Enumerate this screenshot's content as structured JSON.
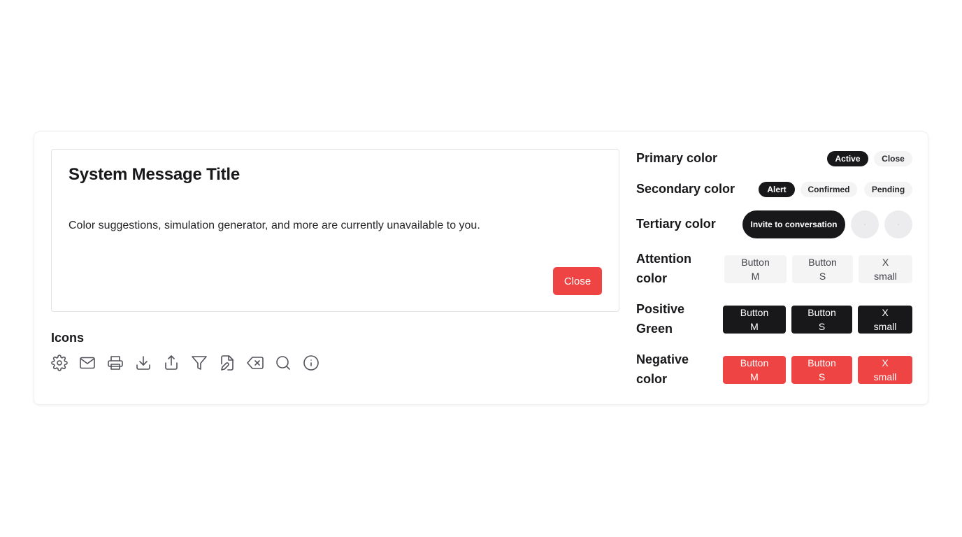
{
  "message": {
    "title": "System Message Title",
    "body": "Color suggestions, simulation generator, and more are currently unavailable to you.",
    "close_label": "Close"
  },
  "icons": {
    "title": "Icons",
    "items": [
      "gear-icon",
      "mail-icon",
      "printer-icon",
      "download-icon",
      "upload-icon",
      "filter-icon",
      "file-edit-icon",
      "backspace-icon",
      "search-icon",
      "info-icon"
    ]
  },
  "colors": {
    "primary": "#18181b",
    "attention_bg": "#f4f4f5",
    "negative": "#ef4444"
  },
  "primary": {
    "label": "Primary color",
    "tags": [
      "Active",
      "Close"
    ]
  },
  "secondary": {
    "label": "Secondary color",
    "tags": [
      "Alert",
      "Confirmed",
      "Pending"
    ]
  },
  "tertiary": {
    "label": "Tertiary color",
    "button": "Invite to conversation"
  },
  "attention": {
    "label_line1": "Attention",
    "label_line2": "color",
    "buttons": [
      {
        "l1": "Button",
        "l2": "M"
      },
      {
        "l1": "Button",
        "l2": "S"
      },
      {
        "l1": "X",
        "l2": "small"
      }
    ]
  },
  "positive": {
    "label_line1": "Positive",
    "label_line2": "Green",
    "buttons": [
      {
        "l1": "Button",
        "l2": "M"
      },
      {
        "l1": "Button",
        "l2": "S"
      },
      {
        "l1": "X",
        "l2": "small"
      }
    ]
  },
  "negative": {
    "label_line1": "Negative",
    "label_line2": "color",
    "buttons": [
      {
        "l1": "Button",
        "l2": "M"
      },
      {
        "l1": "Button",
        "l2": "S"
      },
      {
        "l1": "X",
        "l2": "small"
      }
    ]
  }
}
